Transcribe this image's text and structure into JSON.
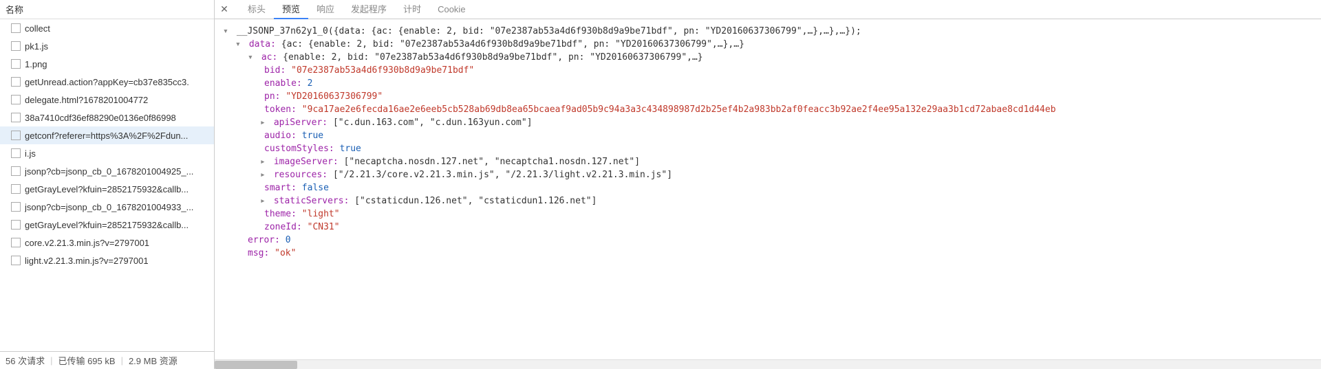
{
  "sidebar": {
    "header": "名称",
    "items": [
      {
        "name": "collect",
        "selected": false
      },
      {
        "name": "pk1.js",
        "selected": false
      },
      {
        "name": "1.png",
        "selected": false
      },
      {
        "name": "getUnread.action?appKey=cb37e835cc3.",
        "selected": false
      },
      {
        "name": "delegate.html?1678201004772",
        "selected": false
      },
      {
        "name": "38a7410cdf36ef88290e0136e0f86998",
        "selected": false
      },
      {
        "name": "getconf?referer=https%3A%2F%2Fdun...",
        "selected": true
      },
      {
        "name": "i.js",
        "selected": false
      },
      {
        "name": "jsonp?cb=jsonp_cb_0_1678201004925_...",
        "selected": false
      },
      {
        "name": "getGrayLevel?kfuin=2852175932&callb...",
        "selected": false
      },
      {
        "name": "jsonp?cb=jsonp_cb_0_1678201004933_...",
        "selected": false
      },
      {
        "name": "getGrayLevel?kfuin=2852175932&callb...",
        "selected": false
      },
      {
        "name": "core.v2.21.3.min.js?v=2797001",
        "selected": false
      },
      {
        "name": "light.v2.21.3.min.js?v=2797001",
        "selected": false
      }
    ]
  },
  "status": {
    "requests": "56 次请求",
    "transferred": "已传输 695 kB",
    "resources": "2.9 MB 资源"
  },
  "tabs": {
    "items": [
      {
        "id": "headers",
        "label": "标头"
      },
      {
        "id": "preview",
        "label": "预览"
      },
      {
        "id": "response",
        "label": "响应"
      },
      {
        "id": "initiator",
        "label": "发起程序"
      },
      {
        "id": "timing",
        "label": "计时"
      },
      {
        "id": "cookies",
        "label": "Cookie"
      }
    ],
    "active": "preview"
  },
  "preview": {
    "jsonp_prefix": "__JSONP_37n62y1_0(",
    "jsonp_summary": "{data: {ac: {enable: 2, bid: \"07e2387ab53a4d6f930b8d9a9be71bdf\", pn: \"YD20160637306799\",…},…},…});",
    "data_label": "data:",
    "data_summary": "{ac: {enable: 2, bid: \"07e2387ab53a4d6f930b8d9a9be71bdf\", pn: \"YD20160637306799\",…},…}",
    "ac_label": "ac:",
    "ac_summary": "{enable: 2, bid: \"07e2387ab53a4d6f930b8d9a9be71bdf\", pn: \"YD20160637306799\",…}",
    "bid_label": "bid:",
    "bid_value": "\"07e2387ab53a4d6f930b8d9a9be71bdf\"",
    "enable_label": "enable:",
    "enable_value": "2",
    "pn_label": "pn:",
    "pn_value": "\"YD20160637306799\"",
    "token_label": "token:",
    "token_value": "\"9ca17ae2e6fecda16ae2e6eeb5cb528ab69db8ea65bcaeaf9ad05b9c94a3a3c434898987d2b25ef4b2a983bb2af0feacc3b92ae2f4ee95a132e29aa3b1cd72abae8cd1d44eb",
    "apiServer_label": "apiServer:",
    "apiServer_value": "[\"c.dun.163.com\", \"c.dun.163yun.com\"]",
    "audio_label": "audio:",
    "audio_value": "true",
    "customStyles_label": "customStyles:",
    "customStyles_value": "true",
    "imageServer_label": "imageServer:",
    "imageServer_value": "[\"necaptcha.nosdn.127.net\", \"necaptcha1.nosdn.127.net\"]",
    "resources_label": "resources:",
    "resources_value": "[\"/2.21.3/core.v2.21.3.min.js\", \"/2.21.3/light.v2.21.3.min.js\"]",
    "smart_label": "smart:",
    "smart_value": "false",
    "staticServers_label": "staticServers:",
    "staticServers_value": "[\"cstaticdun.126.net\", \"cstaticdun1.126.net\"]",
    "theme_label": "theme:",
    "theme_value": "\"light\"",
    "zoneId_label": "zoneId:",
    "zoneId_value": "\"CN31\"",
    "error_label": "error:",
    "error_value": "0",
    "msg_label": "msg:",
    "msg_value": "\"ok\""
  }
}
